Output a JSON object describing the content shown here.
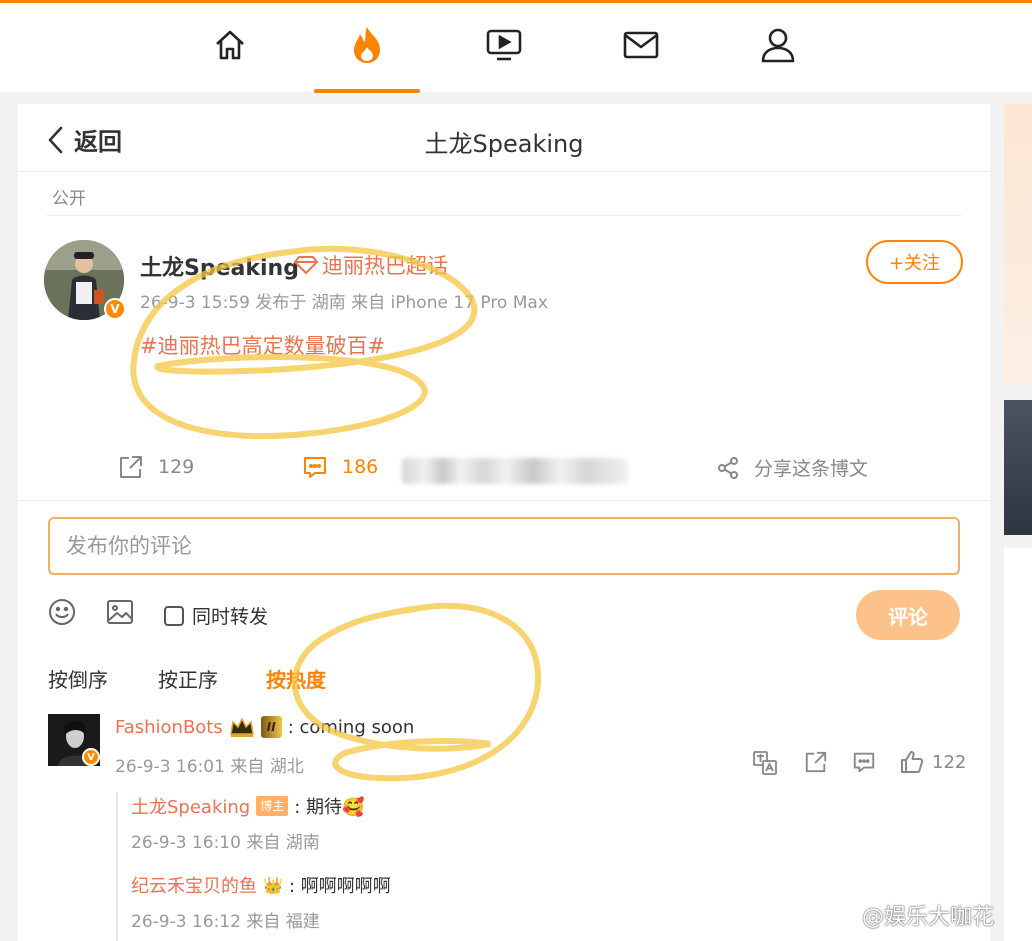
{
  "nav": {
    "items": [
      {
        "name": "home",
        "icon": "home-icon"
      },
      {
        "name": "hot",
        "icon": "flame-icon",
        "active": true
      },
      {
        "name": "video",
        "icon": "video-icon"
      },
      {
        "name": "messages",
        "icon": "mail-icon"
      },
      {
        "name": "profile",
        "icon": "user-icon"
      }
    ],
    "accent": "#ff8200"
  },
  "header": {
    "back_label": "返回",
    "title": "土龙Speaking"
  },
  "post": {
    "visibility": "公开",
    "author": "土龙Speaking",
    "supertopic": "迪丽热巴超话",
    "meta": "26-9-3 15:59  发布于 湖南  来自 iPhone 17 Pro Max",
    "content": "#迪丽热巴高定数量破百#",
    "follow_label": "+关注",
    "reposts": "129",
    "comments": "186",
    "share_label": "分享这条博文"
  },
  "composer": {
    "placeholder": "发布你的评论",
    "repost_label": "同时转发",
    "submit_label": "评论"
  },
  "sort": {
    "tabs": [
      "按倒序",
      "按正序",
      "按热度"
    ],
    "active": "按热度"
  },
  "comments": [
    {
      "user": "FashionBots",
      "badge": "II",
      "text": ": coming soon",
      "meta": "26-9-3 16:01 来自 湖北",
      "likes": "122",
      "replies": [
        {
          "user": "土龙Speaking",
          "badge": "博主",
          "text": ": 期待🥰",
          "meta": "26-9-3 16:10 来自 湖南"
        },
        {
          "user": "纪云禾宝贝的鱼",
          "badge": "👑",
          "text": ": 啊啊啊啊啊",
          "meta": "26-9-3 16:12 来自 福建"
        }
      ]
    }
  ],
  "watermark": "@娱乐大咖花"
}
